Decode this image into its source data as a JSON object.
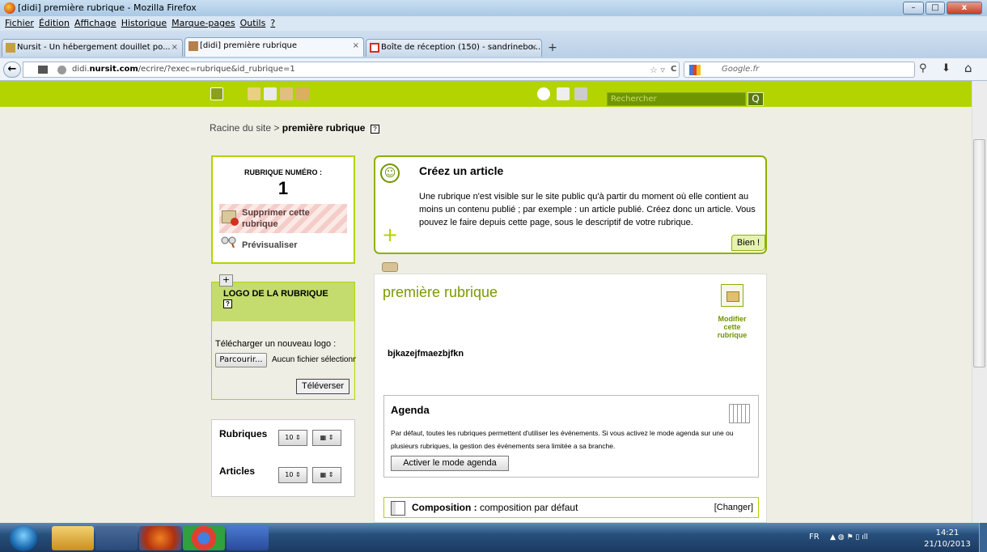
{
  "window": {
    "title": "[didi] première rubrique - Mozilla Firefox",
    "minimize": "–",
    "maximize": "□",
    "close": "x"
  },
  "menu": [
    "Fichier",
    "Édition",
    "Affichage",
    "Historique",
    "Marque-pages",
    "Outils",
    "?"
  ],
  "tabs": [
    {
      "label": "Nursit - Un hébergement douillet po...",
      "close": "×"
    },
    {
      "label": "[didi] première rubrique",
      "close": "×"
    },
    {
      "label": "Boîte de réception (150) - sandrinebo...",
      "close": "×"
    }
  ],
  "new_tab": "+",
  "nav": {
    "back": "←",
    "url_prefix": "didi.",
    "url_domain": "nursit.com",
    "url_path": "/ecrire/?exec=rubrique&id_rubrique=1",
    "search_placeholder": "Google.fr",
    "reload": "C",
    "star": "☆ ▿",
    "search_icon": "⚲",
    "download_icon": "⬇",
    "home_icon": "⌂"
  },
  "spip": {
    "search_placeholder": "Rechercher",
    "search_go": "Q",
    "breadcrumb_root": "Racine du site",
    "breadcrumb_sep": ">",
    "breadcrumb_current": "première rubrique",
    "help": "?",
    "num_label": "RUBRIQUE NUMÉRO :",
    "num_value": "1",
    "delete_label": "Supprimer cette rubrique",
    "preview_label": "Prévisualiser",
    "logo_title": "LOGO DE LA RUBRIQUE",
    "logo_add": "+",
    "logo_upload_label": "Télécharger un nouveau logo :",
    "browse_button": "Parcourir...",
    "no_file": "Aucun fichier sélectionné.",
    "upload_button": "Téléverser",
    "list_rubriques": "Rubriques",
    "list_articles": "Articles",
    "list_btn_a": "10 ⇕",
    "list_btn_b": "▦ ⇕",
    "create_title": "Créez un article",
    "create_text": "Une rubrique n'est visible sur le site public qu'à partir du moment où elle contient au moins un contenu publié ; par exemple : un article publié. Créez donc un article. Vous pouvez le faire depuis cette page, sous le descriptif de votre rubrique.",
    "create_ok": "Bien !",
    "rub_title": "première rubrique",
    "modify_label": "Modifier cette rubrique",
    "rub_desc": "bjkazejfmaezbjfkn",
    "agenda_title": "Agenda",
    "agenda_text": "Par défaut, toutes les rubriques permettent d'utiliser les événements. Si vous activez le mode agenda sur une ou plusieurs rubriques, la gestion des événements sera limitée a sa branche.",
    "agenda_button": "Activer le mode agenda",
    "composition_label": "Composition :",
    "composition_value": "composition par défaut",
    "change": "[Changer]"
  },
  "taskbar": {
    "lang": "FR",
    "time": "14:21",
    "date": "21/10/2013"
  },
  "colors": {
    "spip_green": "#b3d400",
    "dark_green": "#6f9500",
    "taskbar": "#274f7c"
  }
}
